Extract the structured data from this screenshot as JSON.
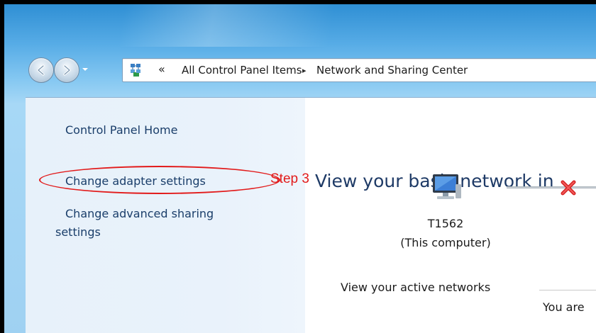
{
  "window": {
    "nav_dropdown_icon": "chevron-down-icon",
    "back_icon": "back-arrow-icon",
    "forward_icon": "forward-arrow-icon"
  },
  "address_bar": {
    "icon": "control-panel-icon",
    "overflow_chevron": "«",
    "crumbs": [
      "All Control Panel Items",
      "Network and Sharing Center"
    ],
    "separator": "▸"
  },
  "sidebar": {
    "items": [
      {
        "label": "Control Panel Home"
      },
      {
        "label": "Change adapter settings"
      },
      {
        "label": "Change advanced sharing"
      },
      {
        "label": "settings"
      }
    ]
  },
  "annotation": {
    "label": "Step 3",
    "color": "#e21b1b"
  },
  "main": {
    "title": "View your basic network in",
    "computer": {
      "icon": "computer-icon",
      "name": "T1562",
      "caption": "(This computer)"
    },
    "connection_status_icon": "red-x-icon",
    "active_networks_header": "View your active networks",
    "status_text": "You are"
  },
  "colors": {
    "link": "#1a3e6a",
    "title": "#1e3a66",
    "sidebar_bg": "#e7f1fa"
  }
}
